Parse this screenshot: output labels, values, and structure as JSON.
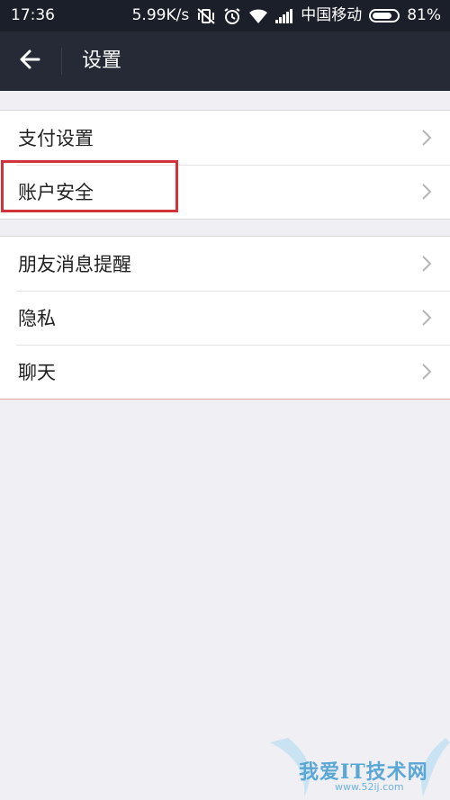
{
  "status_bar": {
    "time": "17:36",
    "speed": "5.99K/s",
    "carrier": "中国移动",
    "battery_percent": "81%",
    "battery_level": 0.81
  },
  "header": {
    "title": "设置",
    "back_icon": "back-arrow-icon"
  },
  "groups": [
    {
      "items": [
        {
          "label": "支付设置"
        },
        {
          "label": "账户安全",
          "highlighted": true
        }
      ]
    },
    {
      "items": [
        {
          "label": "朋友消息提醒"
        },
        {
          "label": "隐私"
        },
        {
          "label": "聊天"
        }
      ]
    }
  ],
  "watermark": {
    "text": "我爱IT技术网",
    "url": "www.52ij.com"
  },
  "colors": {
    "status_bar_bg": "#1b1f2a",
    "header_bg": "#262a37",
    "page_bg": "#efeff4",
    "highlight": "#d0333a"
  }
}
